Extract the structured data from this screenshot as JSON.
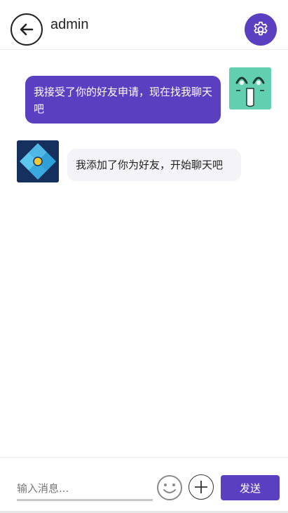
{
  "header": {
    "title": "admin",
    "back_icon": "arrow-left-icon",
    "settings_icon": "gear-icon"
  },
  "messages": [
    {
      "direction": "sent",
      "text": "我接受了你的好友申请，现在找我聊天吧",
      "avatar": "emoji-face-avatar"
    },
    {
      "direction": "received",
      "text": "我添加了你为好友，开始聊天吧",
      "avatar": "diamond-logo-avatar"
    }
  ],
  "input_bar": {
    "placeholder": "输入消息...",
    "value": "",
    "emoji_icon": "smiley-icon",
    "plus_icon": "plus-icon",
    "send_label": "发送"
  },
  "colors": {
    "accent": "#5a3fc0",
    "received_bubble": "#f4f4f8",
    "self_avatar_bg": "#62d0b0",
    "peer_avatar_bg": "#16305e"
  }
}
